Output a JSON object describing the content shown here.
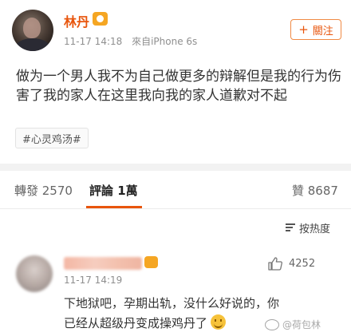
{
  "post": {
    "author": "林丹",
    "time": "11-17 14:18",
    "source": "來自iPhone 6s",
    "follow_label": "關注",
    "follow_plus": "+",
    "text": "做为一个男人我不为自己做更多的辩解但是我的行为伤害了我的家人在这里我向我的家人道歉对不起",
    "tag": "#心灵鸡汤#",
    "accent_color": "#e8550c"
  },
  "tabs": {
    "reposts": "轉發 2570",
    "comments": "評論 1萬",
    "likes": "贊 8687"
  },
  "sort": {
    "label": "按热度",
    "icon": "sort-lines-icon"
  },
  "comment": {
    "time": "11-17 14:19",
    "likes": "4252",
    "text": "下地狱吧，孕期出轨，没什么好说的，你已经从超级丹变成操鸡丹了",
    "emoji": "smile-emoji"
  },
  "watermark": {
    "text": "@荷包林"
  }
}
